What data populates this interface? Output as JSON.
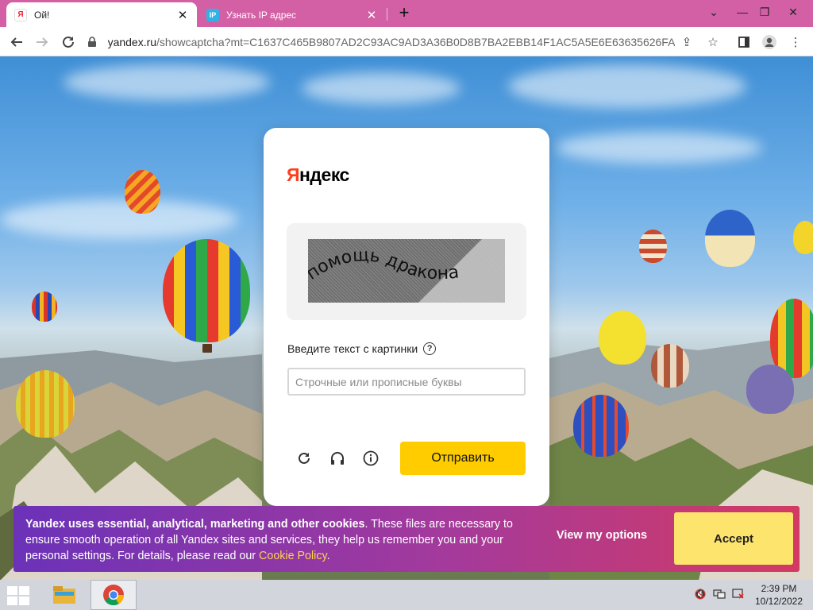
{
  "browser": {
    "tabs": [
      {
        "favicon": "Я",
        "title": "Ой!",
        "active": true
      },
      {
        "favicon": "IP",
        "title": "Узнать IP адрес",
        "active": false
      }
    ],
    "url_host": "yandex.ru",
    "url_path": "/showcaptcha?mt=C1637C465B9807AD2C93AC9AD3A36B0D8B7BA2EBB14F1AC5A5E6E63635626FA7...",
    "icons": [
      "back-icon",
      "forward-icon",
      "reload-icon",
      "lock-icon",
      "share-icon",
      "star-icon",
      "sidepanel-icon",
      "profile-icon",
      "menu-icon"
    ],
    "accent": "#d35fa5"
  },
  "card": {
    "logo_first": "Я",
    "logo_rest": "ндекс",
    "captcha_text": "помощь дракона",
    "prompt": "Введите текст с картинки",
    "input_value": "",
    "input_placeholder": "Строчные или прописные буквы",
    "submit_label": "Отправить",
    "submit_color": "#ffcc00"
  },
  "cookie": {
    "bold_text": "Yandex uses essential, analytical, marketing and other cookies",
    "text": ". These files are necessary to ensure smooth operation of all Yandex sites and services, they help us remember you and your personal settings. For details, please read our ",
    "link_text": "Cookie Policy",
    "end_text": ".",
    "view_options_label": "View my options",
    "accept_label": "Accept"
  },
  "taskbar": {
    "time": "2:39 PM",
    "date": "10/12/2022"
  }
}
